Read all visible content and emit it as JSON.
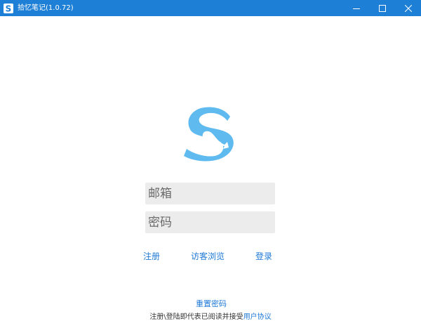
{
  "window": {
    "title": "拾忆笔记(1.0.72)",
    "icons": [
      "app-logo-icon",
      "minimize-icon",
      "maximize-icon",
      "close-icon"
    ],
    "accent_color": "#1e7fd6"
  },
  "logo": {
    "color": "#5fbbef"
  },
  "form": {
    "email_placeholder": "邮箱",
    "password_placeholder": "密码"
  },
  "links": {
    "register": "注册",
    "guest_browse": "访客浏览",
    "login": "登录",
    "reset_password": "重置密码"
  },
  "footer": {
    "notice": "注册\\登陆即代表已阅读并接受",
    "agreement": "用户协议"
  }
}
